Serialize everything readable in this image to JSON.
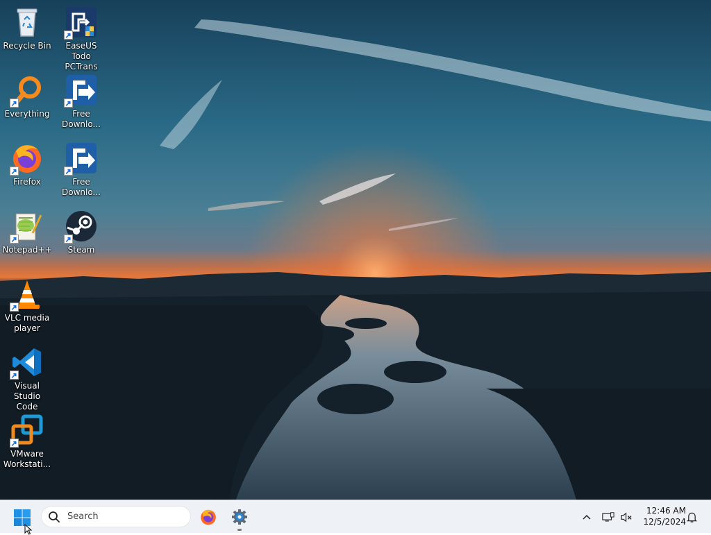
{
  "desktop": {
    "icons": [
      {
        "name": "recycle-bin",
        "label": "Recycle Bin"
      },
      {
        "name": "easeus-todo-pctrans",
        "label": "EaseUS Todo\nPCTrans"
      },
      {
        "name": "everything",
        "label": "Everything"
      },
      {
        "name": "free-download-manager-1",
        "label": "Free\nDownlo..."
      },
      {
        "name": "firefox",
        "label": "Firefox"
      },
      {
        "name": "free-download-manager-2",
        "label": "Free\nDownlo..."
      },
      {
        "name": "notepad-plus-plus",
        "label": "Notepad++"
      },
      {
        "name": "steam",
        "label": "Steam"
      },
      {
        "name": "vlc-media-player",
        "label": "VLC media\nplayer"
      },
      {
        "name": "visual-studio-code",
        "label": "Visual Studio\nCode"
      },
      {
        "name": "vmware-workstation",
        "label": "VMware\nWorkstati..."
      }
    ]
  },
  "taskbar": {
    "start_icon": "windows-logo-icon",
    "search": {
      "placeholder": "Search",
      "icon": "search-icon"
    },
    "pinned": [
      {
        "name": "firefox",
        "icon": "firefox-icon"
      },
      {
        "name": "settings",
        "icon": "gear-icon",
        "running": true
      }
    ],
    "tray": {
      "overflow_icon": "chevron-up-icon",
      "network_icon": "network-icon",
      "volume_icon": "volume-muted-icon",
      "notification_icon": "bell-icon"
    },
    "clock": {
      "time": "12:46 AM",
      "date": "12/5/2024"
    }
  },
  "colors": {
    "taskbar_bg": "#eef1f6",
    "start_blue": "#1e90e6",
    "sky_top": "#1a4a66",
    "sunset": "#e8753a"
  }
}
